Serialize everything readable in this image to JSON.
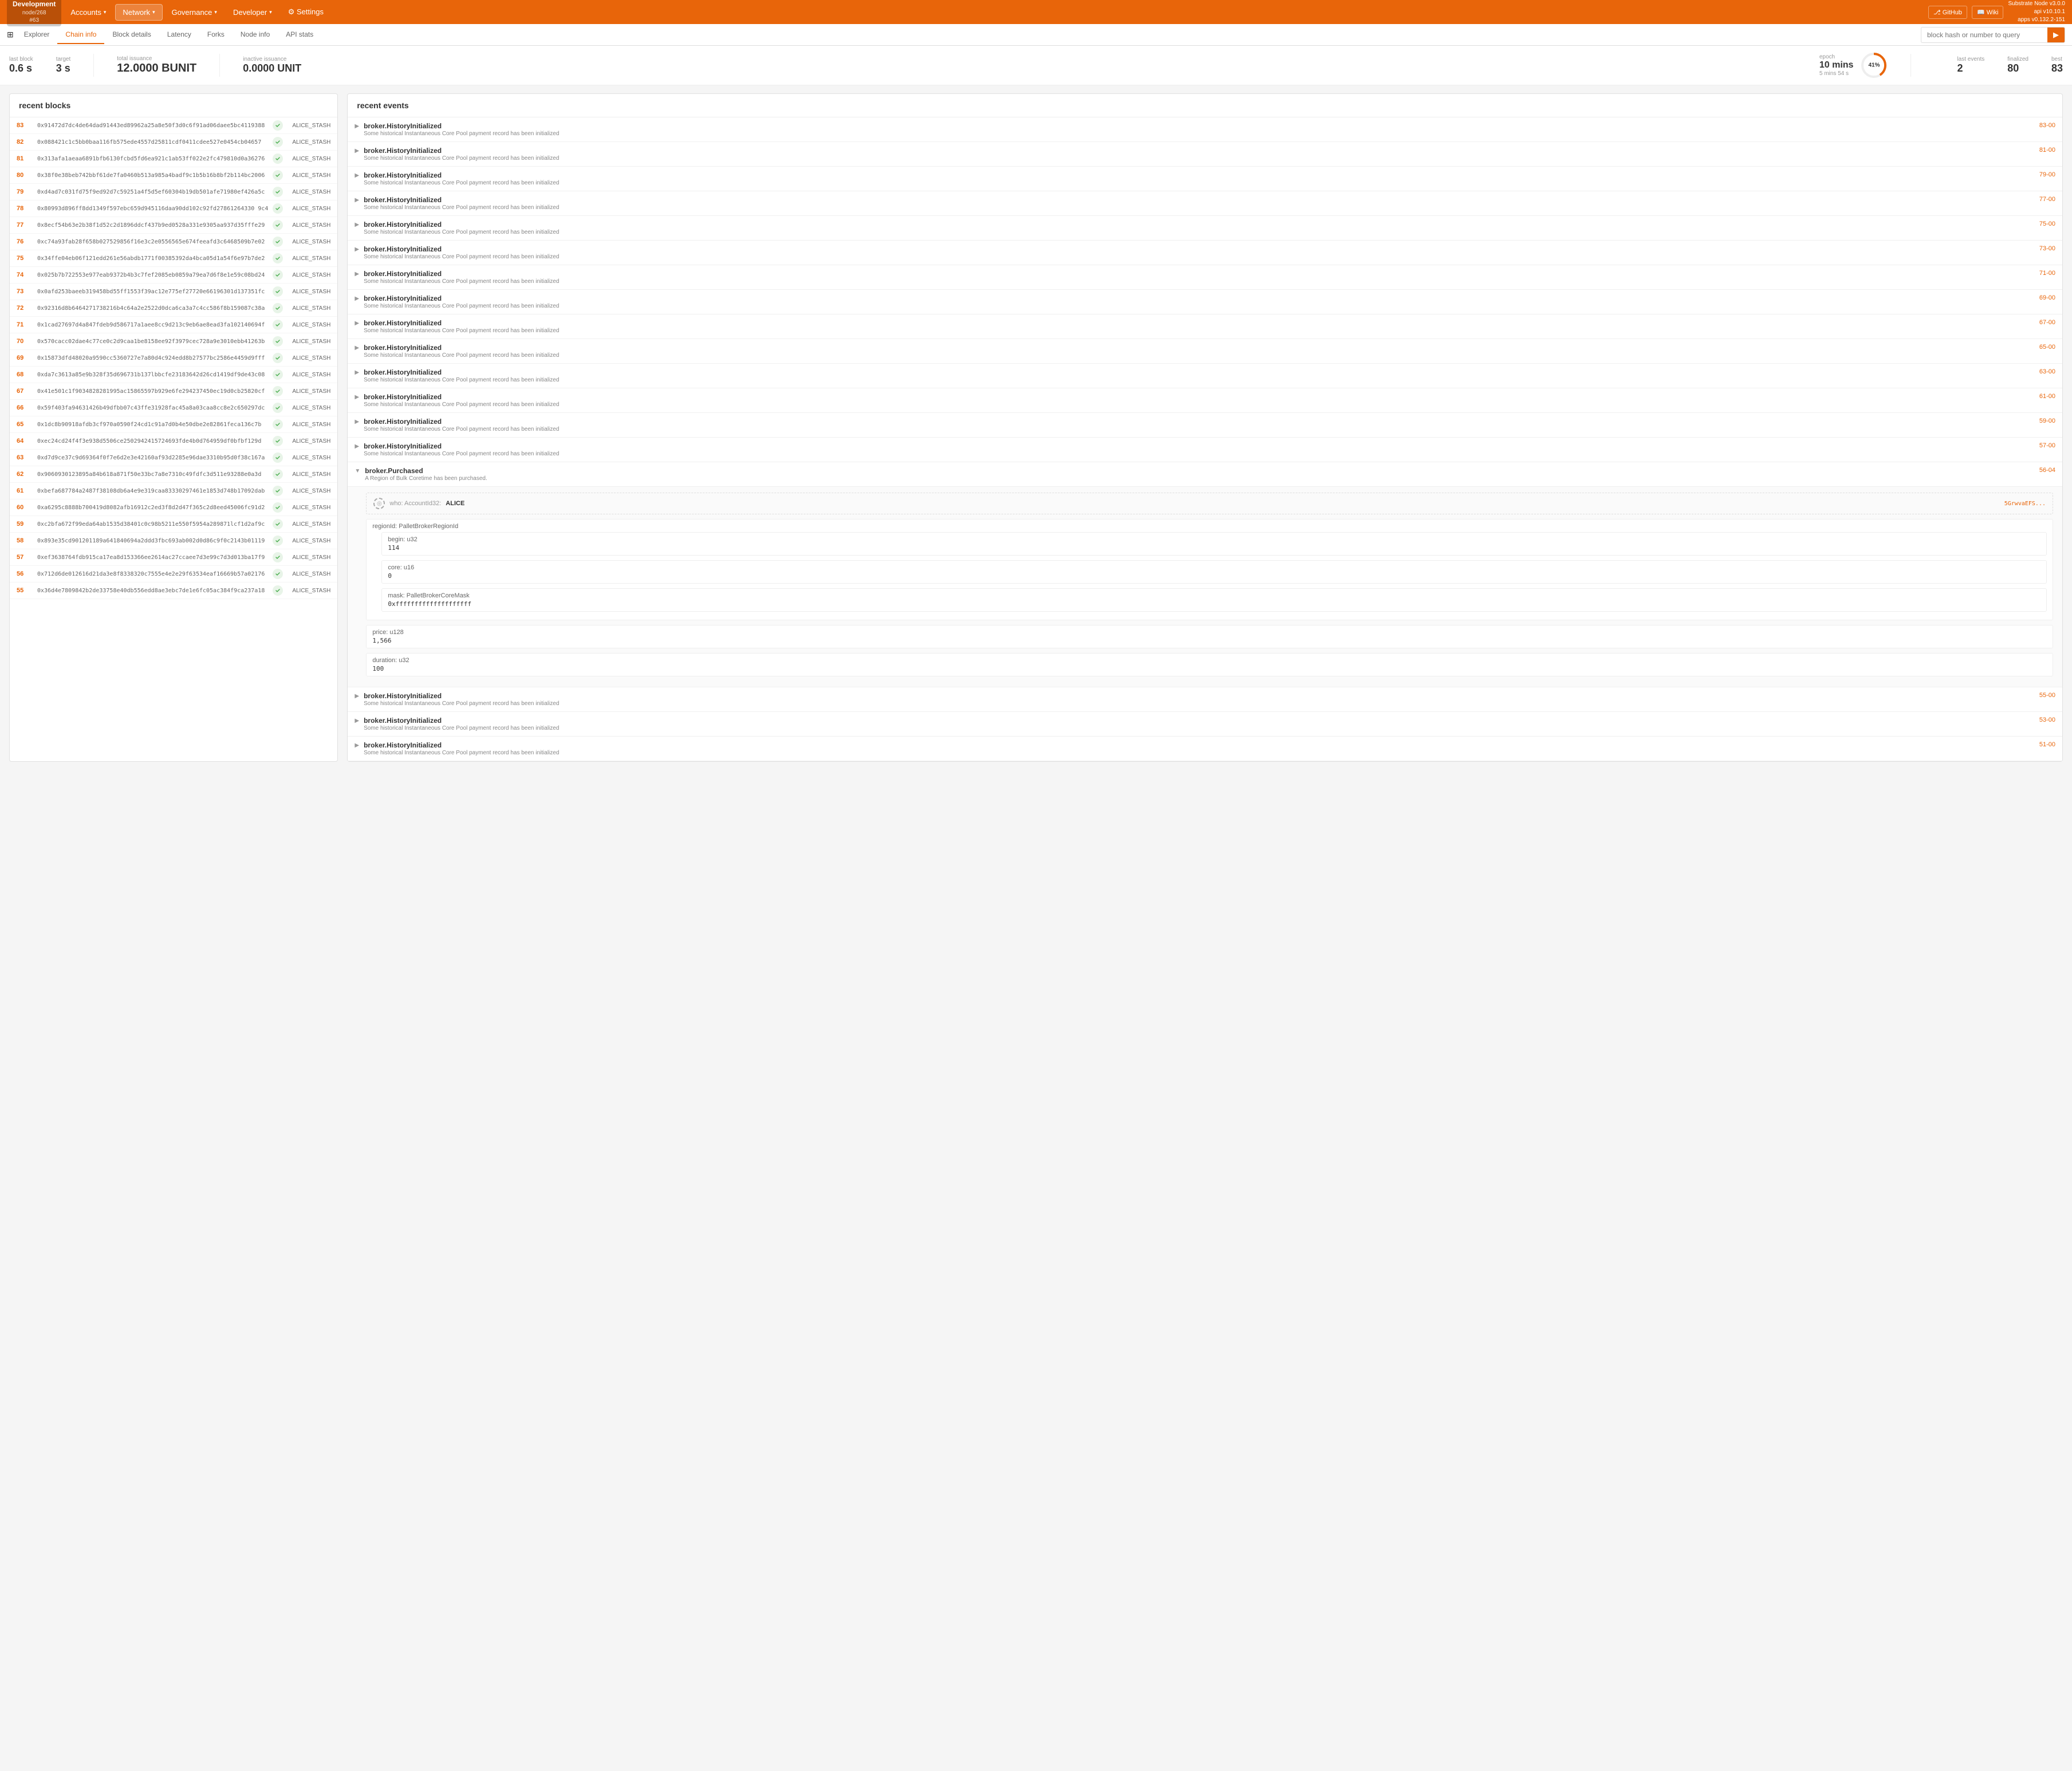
{
  "nav": {
    "brand": {
      "name": "Development",
      "node": "node/268",
      "id": "#63"
    },
    "items": [
      {
        "id": "accounts",
        "label": "Accounts",
        "has_dropdown": true
      },
      {
        "id": "network",
        "label": "Network",
        "has_dropdown": true,
        "active": true
      },
      {
        "id": "governance",
        "label": "Governance",
        "has_dropdown": true
      },
      {
        "id": "developer",
        "label": "Developer",
        "has_dropdown": true
      },
      {
        "id": "settings",
        "label": "⚙ Settings",
        "has_dropdown": false
      }
    ],
    "github_label": "GitHub",
    "wiki_label": "Wiki",
    "version": "Substrate Node v3.0.0\napi v10.10.1\napps v0.132.2-151"
  },
  "subnav": {
    "items": [
      {
        "id": "explorer",
        "label": "Explorer",
        "icon": "⊞"
      },
      {
        "id": "chain-info",
        "label": "Chain info",
        "active": true
      },
      {
        "id": "block-details",
        "label": "Block details"
      },
      {
        "id": "latency",
        "label": "Latency"
      },
      {
        "id": "forks",
        "label": "Forks"
      },
      {
        "id": "node-info",
        "label": "Node info"
      },
      {
        "id": "api-stats",
        "label": "API stats"
      }
    ],
    "search_placeholder": "block hash or number to query"
  },
  "stats": {
    "last_block_label": "last block",
    "last_block_value": "0.6 s",
    "target_label": "target",
    "target_value": "3 s",
    "total_issuance_label": "total issuance",
    "total_issuance_value": "12.0000 BUNIT",
    "inactive_issuance_label": "inactive issuance",
    "inactive_issuance_value": "0.0000 UNIT",
    "epoch_label": "epoch",
    "epoch_mins": "10 mins",
    "epoch_sub": "5 mins 54 s",
    "epoch_pct": "41%",
    "epoch_pct_num": 41,
    "last_events_label": "last events",
    "last_events_value": "2",
    "finalized_label": "finalized",
    "finalized_value": "80",
    "best_label": "best",
    "best_value": "83"
  },
  "recent_blocks": {
    "title": "recent blocks",
    "rows": [
      {
        "num": "83",
        "hash": "0x91472d7dc4de64dad91443ed89962a25a8e50f3d0c6f91ad06daee5bc4119388",
        "author": "ALICE_STASH"
      },
      {
        "num": "82",
        "hash": "0x088421c1c5bb0baa116fb575ede4557d25811cdf0411cdee527e0454cb04657",
        "author": "ALICE_STASH"
      },
      {
        "num": "81",
        "hash": "0x313afa1aeaa6891bfb6130fcbd5fd6ea921c1ab53ff022e2fc479810d0a36276",
        "author": "ALICE_STASH"
      },
      {
        "num": "80",
        "hash": "0x38f0e38beb742bbf61de7fa0460b513a985a4badf9c1b5b16b8bf2b114bc2006",
        "author": "ALICE_STASH"
      },
      {
        "num": "79",
        "hash": "0xd4ad7c031fd75f9ed92d7c59251a4f5d5ef60304b19db501afe71980ef426a5c",
        "author": "ALICE_STASH"
      },
      {
        "num": "78",
        "hash": "0x80993d896ff8dd1349f597ebc659d945116daa90dd102c92fd27861264330 9c4",
        "author": "ALICE_STASH"
      },
      {
        "num": "77",
        "hash": "0x8ecf54b63e2b38f1d52c2d1896ddcf437b9ed0528a331e9305aa937d35fffe29",
        "author": "ALICE_STASH"
      },
      {
        "num": "76",
        "hash": "0xc74a93fab28f658b027529856f16e3c2e0556565e674feeafd3c6468509b7e02",
        "author": "ALICE_STASH"
      },
      {
        "num": "75",
        "hash": "0x34ffe04eb06f121edd261e56abdb1771f00385392da4bca05d1a54f6e97b7de2",
        "author": "ALICE_STASH"
      },
      {
        "num": "74",
        "hash": "0x025b7b722553e977eab9372b4b3c7fef2085eb0859a79ea7d6f8e1e59c08bd24",
        "author": "ALICE_STASH"
      },
      {
        "num": "73",
        "hash": "0x0afd253baeeb319458bd55ff1553f39ac12e775ef27720e66196301d137351fc",
        "author": "ALICE_STASH"
      },
      {
        "num": "72",
        "hash": "0x92316d8b6464271738216b4c64a2e2522d0dca6ca3a7c4cc586f8b159087c38a",
        "author": "ALICE_STASH"
      },
      {
        "num": "71",
        "hash": "0x1cad27697d4a847fdeb9d586717a1aee8cc9d213c9eb6ae8ead3fa102140694f",
        "author": "ALICE_STASH"
      },
      {
        "num": "70",
        "hash": "0x570cacc02dae4c77ce0c2d9caa1be8158ee92f3979cec728a9e3010ebb41263b",
        "author": "ALICE_STASH"
      },
      {
        "num": "69",
        "hash": "0x15873dfd48020a9590cc5360727e7a80d4c924edd8b27577bc2586e4459d9fff",
        "author": "ALICE_STASH"
      },
      {
        "num": "68",
        "hash": "0xda7c3613a85e9b328f35d696731b137lbbcfe23183642d26cd1419df9de43c08",
        "author": "ALICE_STASH"
      },
      {
        "num": "67",
        "hash": "0x41e501c1f9034828281995ac15865597b929e6fe294237450ec19d0cb25820cf",
        "author": "ALICE_STASH"
      },
      {
        "num": "66",
        "hash": "0x59f403fa94631426b49dfbb07c43ffe31928fac45a8a03caa8cc8e2c650297dc",
        "author": "ALICE_STASH"
      },
      {
        "num": "65",
        "hash": "0x1dc8b90918afdb3cf970a0590f24cd1c91a7d0b4e50dbe2e82861feca136c7b",
        "author": "ALICE_STASH"
      },
      {
        "num": "64",
        "hash": "0xec24cd24f4f3e938d5506ce2502942415724693fde4b0d764959df0bfbf129d",
        "author": "ALICE_STASH"
      },
      {
        "num": "63",
        "hash": "0xd7d9ce37c9d69364f0f7e6d2e3e42160af93d2285e96dae3310b95d0f38c167a",
        "author": "ALICE_STASH"
      },
      {
        "num": "62",
        "hash": "0x9060930123895a84b618a871f50e33bc7a8e7310c49fdfc3d511e93288e0a3d",
        "author": "ALICE_STASH"
      },
      {
        "num": "61",
        "hash": "0xbefa687784a2487f38108db6a4e9e319caa83330297461e1853d748b17092dab",
        "author": "ALICE_STASH"
      },
      {
        "num": "60",
        "hash": "0xa6295c8888b700419d8082afb16912c2ed3f8d2d47f365c2d8eed45006fc91d2",
        "author": "ALICE_STASH"
      },
      {
        "num": "59",
        "hash": "0xc2bfa672f99eda64ab1535d38401c0c98b5211e550f5954a289871lcf1d2af9c",
        "author": "ALICE_STASH"
      },
      {
        "num": "58",
        "hash": "0x893e35cd901201189a641840694a2ddd3fbc693ab002d0d86c9f0c2143b01119",
        "author": "ALICE_STASH"
      },
      {
        "num": "57",
        "hash": "0xef3638764fdb915ca17ea8d153366ee2614ac27ccaee7d3e99c7d3d013ba17f9",
        "author": "ALICE_STASH"
      },
      {
        "num": "56",
        "hash": "0x712d6de012616d21da3e8f8338320c7555e4e2e29f63534eaf16669b57a02176",
        "author": "ALICE_STASH"
      },
      {
        "num": "55",
        "hash": "0x36d4e7809842b2de33758e40db556edd8ae3ebc7de1e6fc05ac384f9ca237a18",
        "author": "ALICE_STASH"
      }
    ]
  },
  "recent_events": {
    "title": "recent events",
    "events": [
      {
        "id": "e1",
        "name": "broker.HistoryInitialized",
        "desc": "Some historical Instantaneous Core Pool payment record has been initialized",
        "ref": "83-00",
        "expanded": false
      },
      {
        "id": "e2",
        "name": "broker.HistoryInitialized",
        "desc": "Some historical Instantaneous Core Pool payment record has been initialized",
        "ref": "81-00",
        "expanded": false
      },
      {
        "id": "e3",
        "name": "broker.HistoryInitialized",
        "desc": "Some historical Instantaneous Core Pool payment record has been initialized",
        "ref": "79-00",
        "expanded": false
      },
      {
        "id": "e4",
        "name": "broker.HistoryInitialized",
        "desc": "Some historical Instantaneous Core Pool payment record has been initialized",
        "ref": "77-00",
        "expanded": false
      },
      {
        "id": "e5",
        "name": "broker.HistoryInitialized",
        "desc": "Some historical Instantaneous Core Pool payment record has been initialized",
        "ref": "75-00",
        "expanded": false
      },
      {
        "id": "e6",
        "name": "broker.HistoryInitialized",
        "desc": "Some historical Instantaneous Core Pool payment record has been initialized",
        "ref": "73-00",
        "expanded": false
      },
      {
        "id": "e7",
        "name": "broker.HistoryInitialized",
        "desc": "Some historical Instantaneous Core Pool payment record has been initialized",
        "ref": "71-00",
        "expanded": false
      },
      {
        "id": "e8",
        "name": "broker.HistoryInitialized",
        "desc": "Some historical Instantaneous Core Pool payment record has been initialized",
        "ref": "69-00",
        "expanded": false
      },
      {
        "id": "e9",
        "name": "broker.HistoryInitialized",
        "desc": "Some historical Instantaneous Core Pool payment record has been initialized",
        "ref": "67-00",
        "expanded": false
      },
      {
        "id": "e10",
        "name": "broker.HistoryInitialized",
        "desc": "Some historical Instantaneous Core Pool payment record has been initialized",
        "ref": "65-00",
        "expanded": false
      },
      {
        "id": "e11",
        "name": "broker.HistoryInitialized",
        "desc": "Some historical Instantaneous Core Pool payment record has been initialized",
        "ref": "63-00",
        "expanded": false
      },
      {
        "id": "e12",
        "name": "broker.HistoryInitialized",
        "desc": "Some historical Instantaneous Core Pool payment record has been initialized",
        "ref": "61-00",
        "expanded": false
      },
      {
        "id": "e13",
        "name": "broker.HistoryInitialized",
        "desc": "Some historical Instantaneous Core Pool payment record has been initialized",
        "ref": "59-00",
        "expanded": false
      },
      {
        "id": "e14",
        "name": "broker.HistoryInitialized",
        "desc": "Some historical Instantaneous Core Pool payment record has been initialized",
        "ref": "57-00",
        "expanded": false
      },
      {
        "id": "e15",
        "name": "broker.Purchased",
        "desc": "A Region of Bulk Coretime has been purchased.",
        "ref": "56-04",
        "expanded": true,
        "who_label": "who: AccountId32",
        "who_name": "ALICE",
        "who_addr": "5GrwvaEFS...",
        "fields": [
          {
            "label": "regionId: PalletBrokerRegionId",
            "sub_fields": [
              {
                "label": "begin: u32",
                "value": "114"
              },
              {
                "label": "core: u16",
                "value": "0"
              },
              {
                "label": "mask: PalletBrokerCoreMask",
                "value": "0xffffffffffffffffffff"
              }
            ]
          },
          {
            "label": "price: u128",
            "value": "1,566"
          },
          {
            "label": "duration: u32",
            "value": "100"
          }
        ]
      },
      {
        "id": "e16",
        "name": "broker.HistoryInitialized",
        "desc": "Some historical Instantaneous Core Pool payment record has been initialized",
        "ref": "55-00",
        "expanded": false
      },
      {
        "id": "e17",
        "name": "broker.HistoryInitialized",
        "desc": "Some historical Instantaneous Core Pool payment record has been initialized",
        "ref": "53-00",
        "expanded": false
      },
      {
        "id": "e18",
        "name": "broker.HistoryInitialized",
        "desc": "Some historical Instantaneous Core Pool payment record has been initialized",
        "ref": "51-00",
        "expanded": false
      }
    ]
  }
}
